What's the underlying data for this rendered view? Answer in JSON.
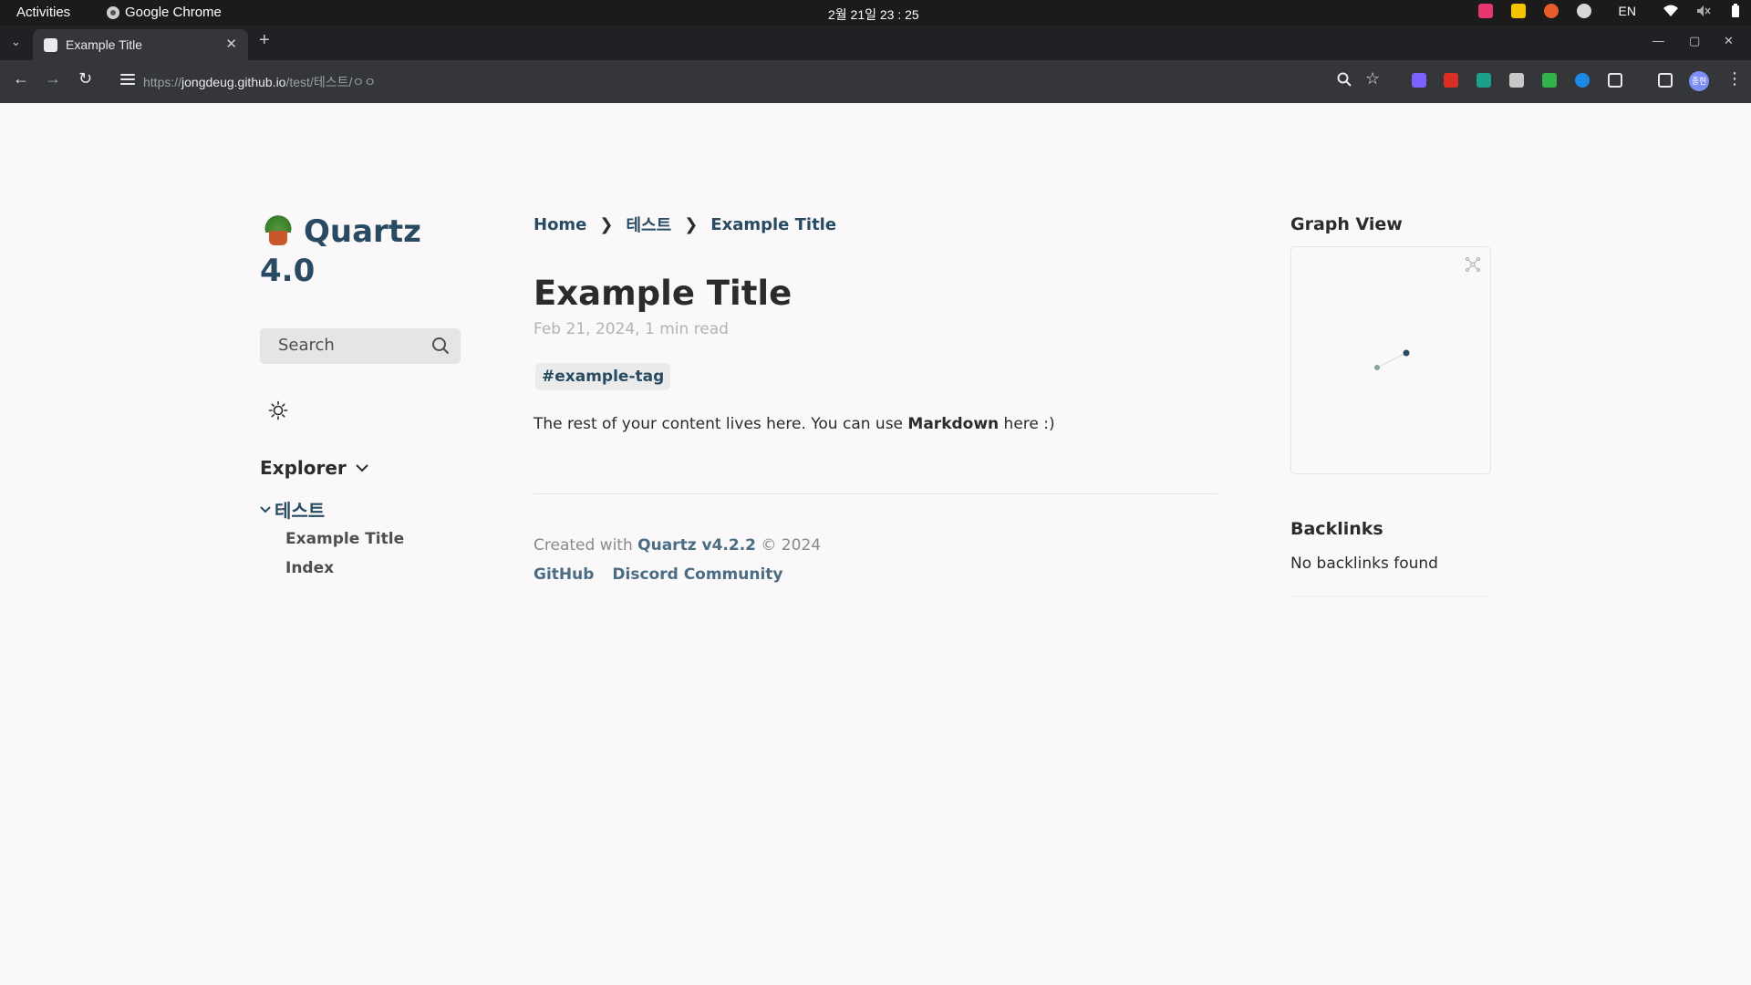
{
  "system_bar": {
    "activities": "Activities",
    "app_name": "Google Chrome",
    "clock": "2월 21일 23 : 25",
    "language": "EN"
  },
  "browser": {
    "tab_title": "Example Title",
    "url_scheme": "https://",
    "url_host": "jongdeug.github.io",
    "url_path": "/test/테스트/ㅇㅇ"
  },
  "sidebar": {
    "site_title": "Quartz 4.0",
    "search_label": "Search",
    "explorer_label": "Explorer",
    "folder_name": "테스트",
    "files": [
      "Example Title",
      "Index"
    ]
  },
  "article": {
    "breadcrumbs": [
      "Home",
      "테스트",
      "Example Title"
    ],
    "breadcrumb_separator": "❯",
    "title": "Example Title",
    "meta": "Feb 21, 2024, 1 min read",
    "tag": "#example-tag",
    "body_before": "The rest of your content lives here. You can use ",
    "body_bold": "Markdown",
    "body_after": " here :)"
  },
  "footer": {
    "created_with": "Created with ",
    "quartz_version": "Quartz v4.2.2",
    "copyright": " © 2024",
    "links": [
      "GitHub",
      "Discord Community"
    ]
  },
  "right_sidebar": {
    "graph_heading": "Graph View",
    "backlinks_heading": "Backlinks",
    "backlinks_empty": "No backlinks found"
  },
  "colors": {
    "page_bg": "#faf8f8",
    "link": "#284b63",
    "text": "#2b2b2b",
    "muted": "#b3b3b3"
  }
}
